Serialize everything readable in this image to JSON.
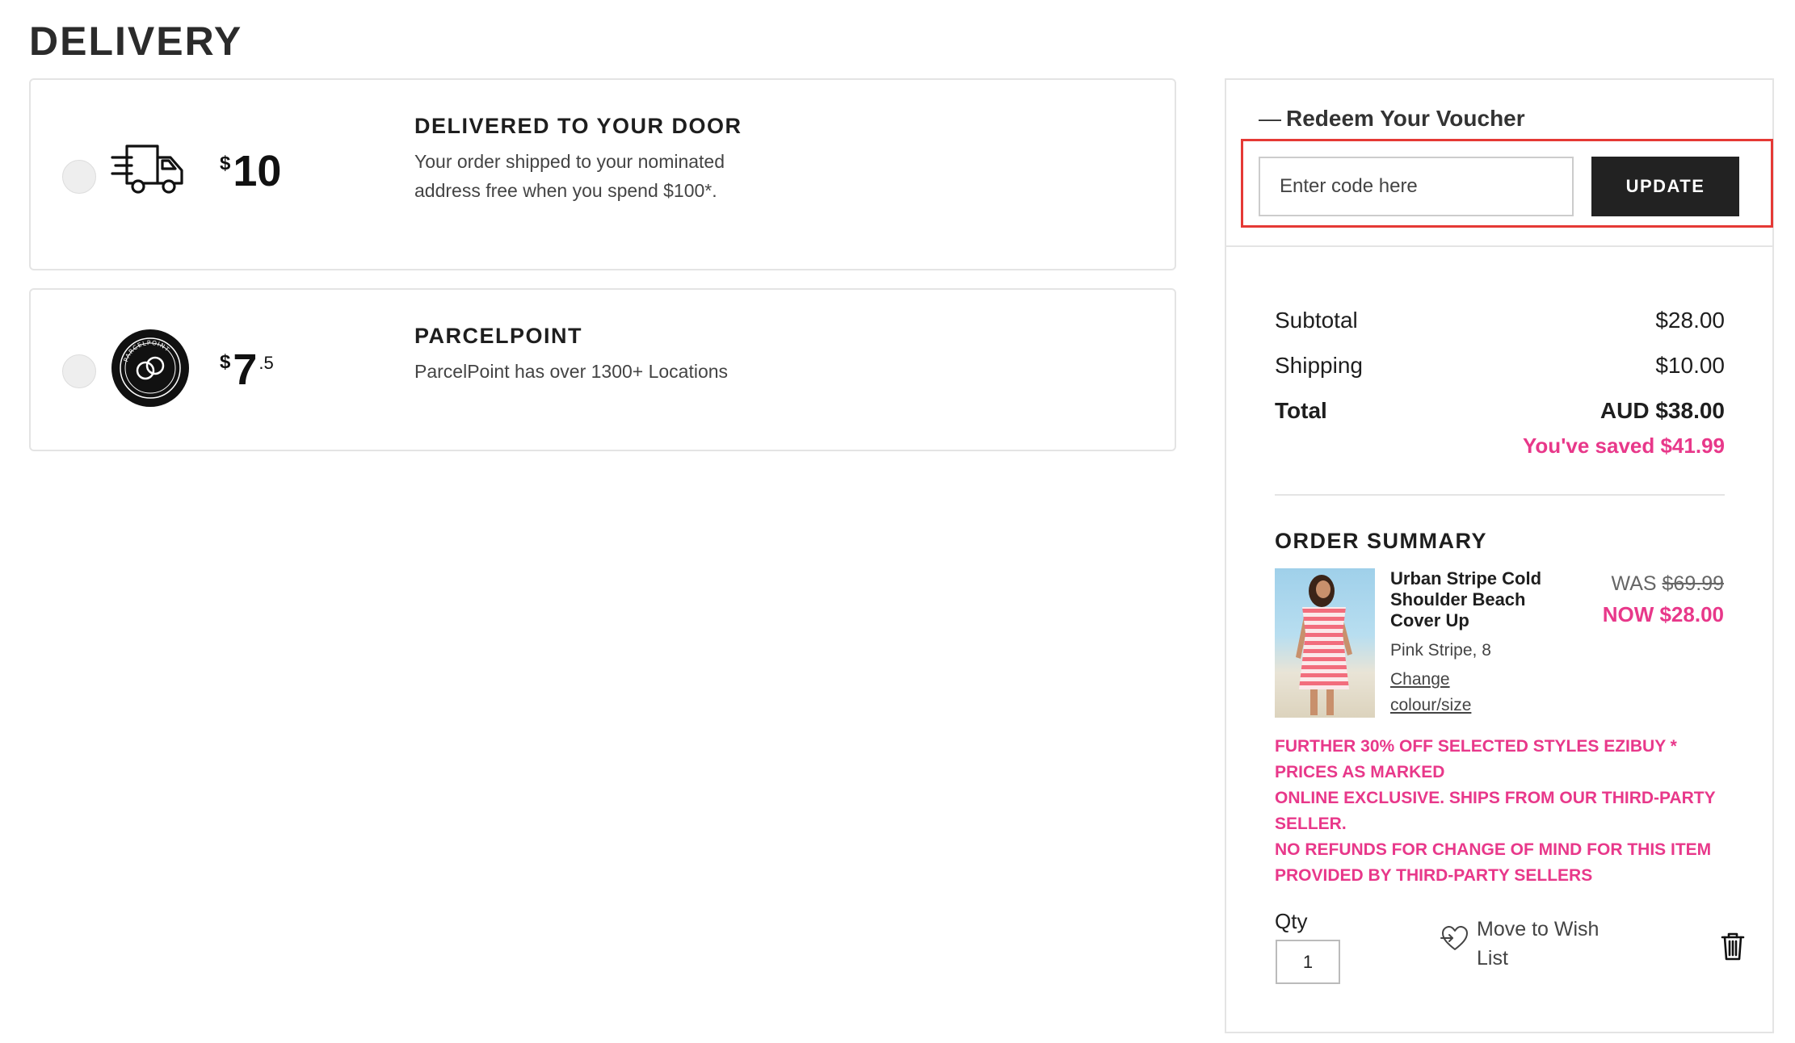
{
  "page": {
    "title": "DELIVERY"
  },
  "delivery_options": [
    {
      "icon": "delivery-truck-icon",
      "currency": "$",
      "price_main": "10",
      "price_cents": "",
      "title": "DELIVERED TO YOUR DOOR",
      "description": "Your order shipped to your nominated address free when you spend $100*.",
      "selected": false
    },
    {
      "icon": "parcelpoint-logo-icon",
      "currency": "$",
      "price_main": "7",
      "price_cents": ".5",
      "title": "PARCELPOINT",
      "description": "ParcelPoint has over 1300+ Locations",
      "logo_text": "PARCELPOINT",
      "selected": false
    }
  ],
  "voucher": {
    "heading_dash": "—",
    "heading": "Redeem Your Voucher",
    "placeholder": "Enter code here",
    "button_label": "UPDATE",
    "highlight_color": "#e53935"
  },
  "totals": {
    "subtotal_label": "Subtotal",
    "subtotal_value": "$28.00",
    "shipping_label": "Shipping",
    "shipping_value": "$10.00",
    "total_label": "Total",
    "total_value": "AUD $38.00",
    "saved_text": "You've saved $41.99"
  },
  "order_summary": {
    "title": "ORDER SUMMARY",
    "item": {
      "name": "Urban Stripe Cold Shoulder Beach Cover Up",
      "variant": "Pink Stripe, 8",
      "change_link": "Change colour/size",
      "was_label": "WAS",
      "was_price": "$69.99",
      "now_price": "NOW $28.00",
      "promo_lines": [
        "FURTHER 30% OFF SELECTED STYLES EZIBUY * PRICES AS MARKED",
        "ONLINE EXCLUSIVE. SHIPS FROM OUR THIRD-PARTY SELLER.",
        "NO REFUNDS FOR CHANGE OF MIND FOR THIS ITEM PROVIDED BY THIRD-PARTY SELLERS"
      ],
      "qty_label": "Qty",
      "qty_value": "1",
      "wishlist_label": "Move to Wish List"
    }
  },
  "colors": {
    "accent_pink": "#e8388a",
    "button_dark": "#222222",
    "border": "#e4e4e4"
  }
}
